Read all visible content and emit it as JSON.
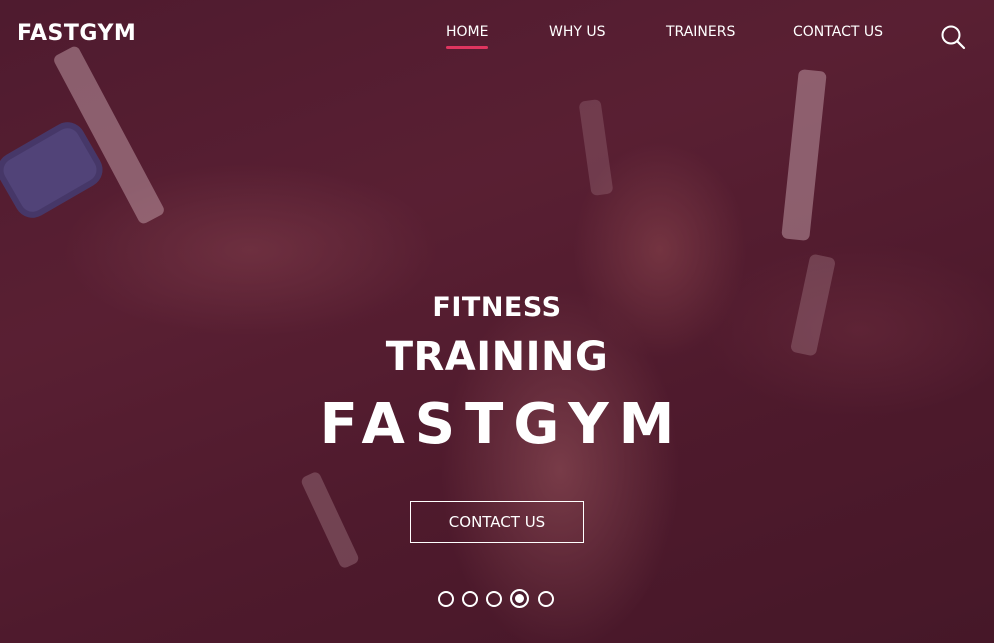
{
  "brand": {
    "logo_text": "FASTGYM"
  },
  "nav": {
    "items": [
      {
        "label": "HOME",
        "active": true
      },
      {
        "label": "WHY US",
        "active": false
      },
      {
        "label": "TRAINERS",
        "active": false
      },
      {
        "label": "CONTACT US",
        "active": false
      }
    ],
    "search_icon": "search-icon"
  },
  "hero": {
    "line1": "FITNESS",
    "line2": "TRAINING",
    "line3": "FASTGYM",
    "cta_label": "CONTACT US"
  },
  "slider": {
    "slide_count": 5,
    "active_index": 3
  },
  "colors": {
    "accent": "#e0355f",
    "overlay": "#4a1c2e",
    "text": "#ffffff"
  }
}
